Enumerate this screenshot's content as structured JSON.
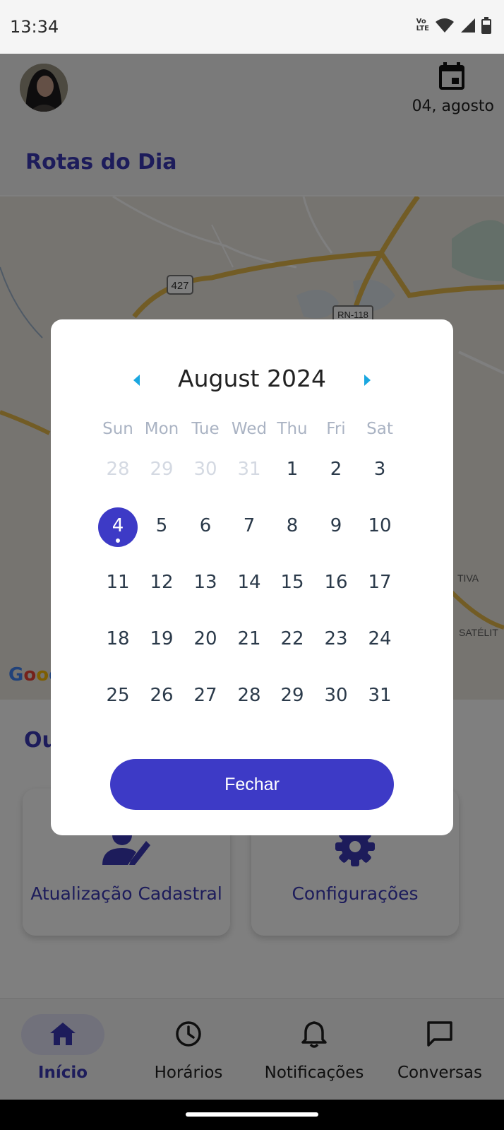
{
  "status_bar": {
    "time": "13:34",
    "volte_top": "Vo",
    "volte_bottom": "LTE",
    "icons": [
      "volte-icon",
      "wifi-icon",
      "signal-icon",
      "battery-icon"
    ]
  },
  "header": {
    "date": "04, agosto",
    "section_title": "Rotas do Dia",
    "calendar_icon": "calendar-icon"
  },
  "map": {
    "labels": [
      "427",
      "RN-118",
      "TIVA",
      "SATÉLIT"
    ],
    "provider": [
      "G",
      "o",
      "o",
      "g"
    ]
  },
  "others": {
    "title": "Ou",
    "cards": [
      {
        "label": "Atualização Cadastral",
        "icon": "user-edit-icon"
      },
      {
        "label": "Configurações",
        "icon": "gear-icon"
      }
    ]
  },
  "bottom_nav": [
    {
      "label": "Início",
      "icon": "home-icon",
      "active": true
    },
    {
      "label": "Horários",
      "icon": "clock-icon",
      "active": false
    },
    {
      "label": "Notificações",
      "icon": "bell-icon",
      "active": false
    },
    {
      "label": "Conversas",
      "icon": "chat-icon",
      "active": false
    }
  ],
  "calendar": {
    "month_title": "August 2024",
    "weekdays": [
      "Sun",
      "Mon",
      "Tue",
      "Wed",
      "Thu",
      "Fri",
      "Sat"
    ],
    "weeks": [
      [
        "28",
        "29",
        "30",
        "31",
        "1",
        "2",
        "3"
      ],
      [
        "4",
        "5",
        "6",
        "7",
        "8",
        "9",
        "10"
      ],
      [
        "11",
        "12",
        "13",
        "14",
        "15",
        "16",
        "17"
      ],
      [
        "18",
        "19",
        "20",
        "21",
        "22",
        "23",
        "24"
      ],
      [
        "25",
        "26",
        "27",
        "28",
        "29",
        "30",
        "31"
      ]
    ],
    "muted_days": [
      "28",
      "29",
      "30",
      "31"
    ],
    "selected_day": "4",
    "close_label": "Fechar",
    "accent_color": "#3d3ac6",
    "arrow_color": "#1aa7e0"
  }
}
